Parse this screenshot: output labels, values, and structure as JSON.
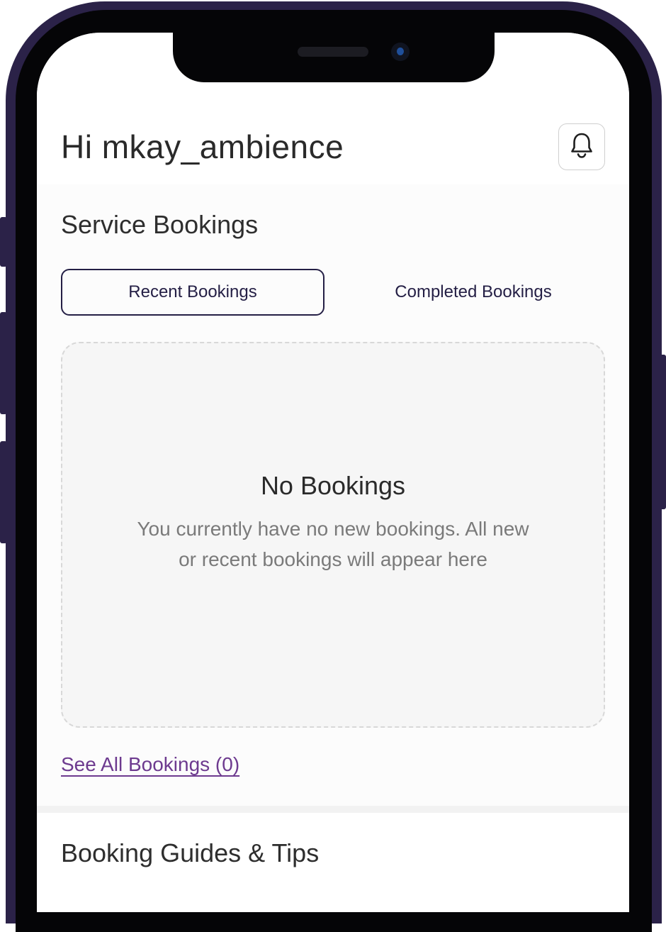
{
  "header": {
    "greeting": "Hi mkay_ambience"
  },
  "bookings": {
    "section_title": "Service Bookings",
    "tabs": [
      {
        "label": "Recent Bookings",
        "active": true
      },
      {
        "label": "Completed Bookings",
        "active": false
      }
    ],
    "empty_state": {
      "title": "No Bookings",
      "description": "You currently have no new bookings. All new or recent bookings will appear here"
    },
    "see_all_link": "See All Bookings (0)"
  },
  "guides": {
    "section_title": "Booking Guides & Tips"
  },
  "icons": {
    "notification": "bell-icon"
  },
  "colors": {
    "frame": "#2b2248",
    "accent": "#241f45",
    "link": "#6d3a8f"
  }
}
